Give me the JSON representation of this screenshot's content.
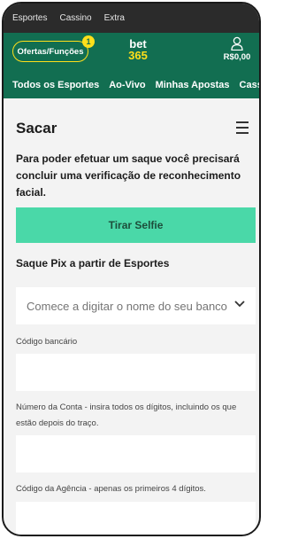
{
  "topbar": {
    "items": [
      "Esportes",
      "Cassino",
      "Extra"
    ]
  },
  "header": {
    "offers_label": "Ofertas/Funções",
    "offers_badge": "1",
    "logo_top": "bet",
    "logo_bottom": "365",
    "balance": "R$0,00"
  },
  "nav": {
    "items": [
      "Todos os Esportes",
      "Ao-Vivo",
      "Minhas Apostas",
      "Cassino"
    ]
  },
  "page": {
    "title": "Sacar",
    "info": "Para poder efetuar um saque você precisará concluir uma verificação de reconhecimento facial.",
    "selfie_button": "Tirar Selfie",
    "section_title": "Saque Pix a partir de Esportes",
    "bank_placeholder": "Comece a digitar o nome do seu banco",
    "bank_code_label": "Código bancário",
    "account_label": "Número da Conta - insira todos os dígitos, incluindo os que estão depois do traço.",
    "agency_label": "Código da Agência - apenas os primeiros 4 dígitos."
  },
  "colors": {
    "brand_green": "#126e51",
    "accent_yellow": "#ffdf1b",
    "button_green": "#4ad8a8"
  },
  "icons": [
    "user-icon",
    "hamburger-menu-icon",
    "chevron-down-icon"
  ]
}
